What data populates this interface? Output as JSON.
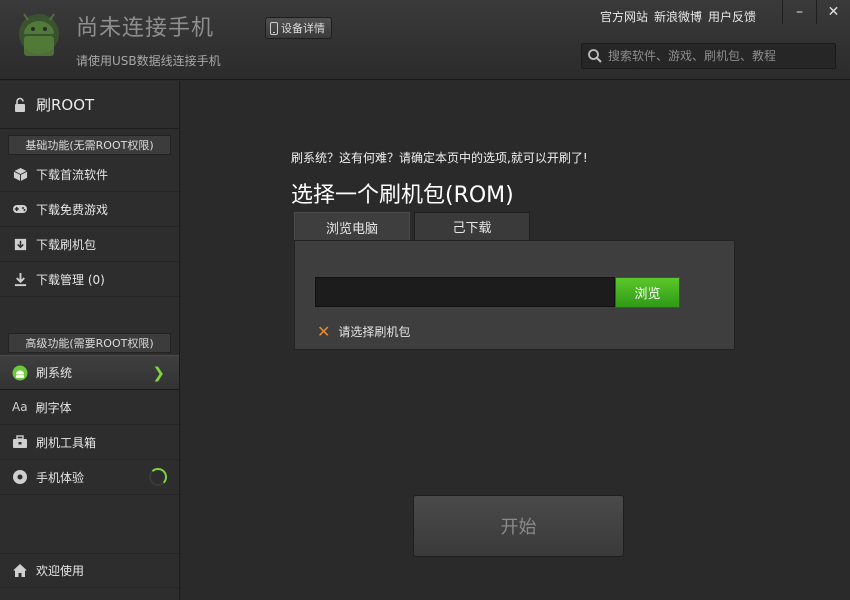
{
  "header": {
    "title": "尚未连接手机",
    "subtitle": "请使用USB数据线连接手机",
    "device_button": "设备详情",
    "links": [
      "官方网站",
      "新浪微博",
      "用户反馈"
    ],
    "search_placeholder": "搜索软件、游戏、刷机包、教程",
    "window_controls": {
      "minimize": "–",
      "close": "✕"
    }
  },
  "sidebar": {
    "root_item": "刷ROOT",
    "section_basic": "基础功能(无需ROOT权限)",
    "basic_items": [
      {
        "label": "下载首流软件",
        "icon": "cube-icon"
      },
      {
        "label": "下载免费游戏",
        "icon": "gamepad-icon"
      },
      {
        "label": "下载刷机包",
        "icon": "package-icon"
      },
      {
        "label": "下载管理 (0)",
        "icon": "download-icon"
      }
    ],
    "section_advanced": "高级功能(需要ROOT权限)",
    "advanced_items": [
      {
        "label": "刷系统",
        "icon": "android-icon",
        "active": true
      },
      {
        "label": "刷字体",
        "icon": "font-icon",
        "glyph": "Aa"
      },
      {
        "label": "刷机工具箱",
        "icon": "toolbox-icon"
      },
      {
        "label": "手机体验",
        "icon": "experience-icon",
        "loading": true
      }
    ],
    "welcome": "欢迎使用"
  },
  "main": {
    "hint": "刷系统？这有何难？请确定本页中的选项,就可以开刷了!",
    "heading": "选择一个刷机包(ROM)",
    "tabs": [
      "浏览电脑",
      "己下载"
    ],
    "path_value": "",
    "browse_button": "浏览",
    "warning": "请选择刷机包",
    "start_button": "开始"
  },
  "colors": {
    "accent_green": "#5cc72a",
    "warning_orange": "#e7892c"
  }
}
